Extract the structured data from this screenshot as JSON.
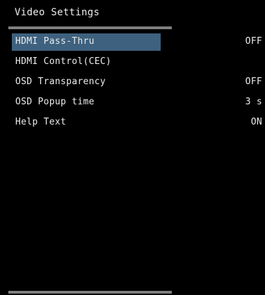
{
  "menu": {
    "title": "Video Settings",
    "selected_index": 0,
    "items": [
      {
        "label": "HDMI Pass-Thru",
        "value": "OFF"
      },
      {
        "label": "HDMI Control(CEC)",
        "value": ""
      },
      {
        "label": "OSD Transparency",
        "value": "OFF"
      },
      {
        "label": "OSD Popup time",
        "value": "3 s"
      },
      {
        "label": "Help Text",
        "value": "ON"
      }
    ]
  },
  "colors": {
    "background": "#000000",
    "text": "#ececec",
    "highlight": "#3d617e",
    "divider": "#7f7f7f"
  }
}
